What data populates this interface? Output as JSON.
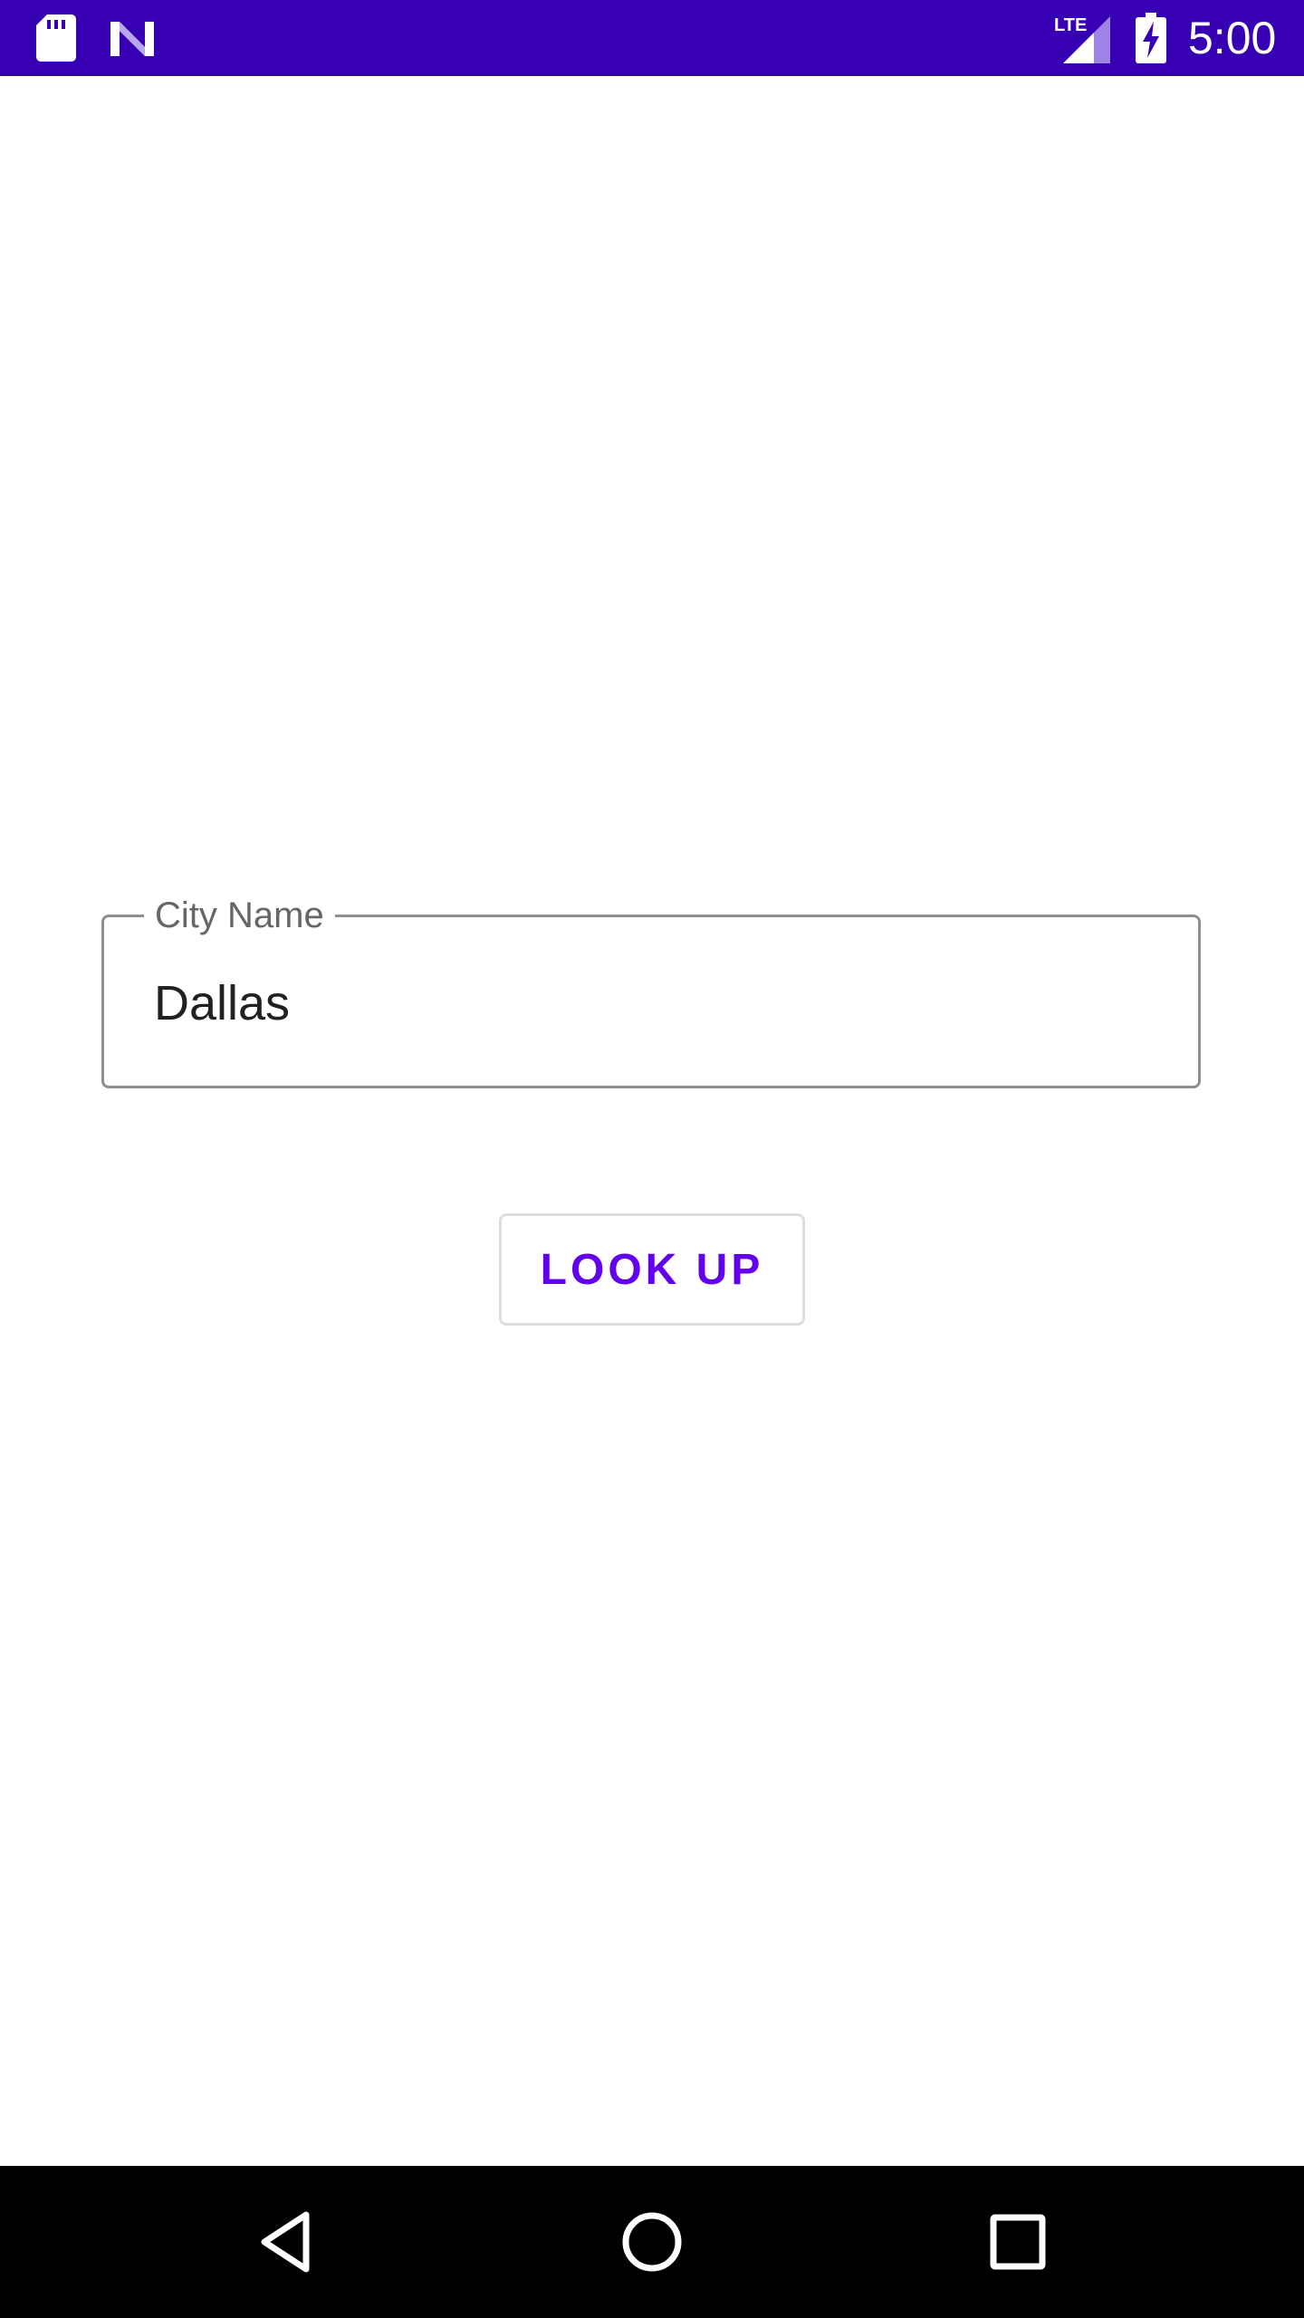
{
  "status_bar": {
    "time": "5:00",
    "network_label": "LTE",
    "background_color": "#3700b3",
    "icons": [
      "sd-card-icon",
      "n-logo-icon",
      "lte-signal-icon",
      "battery-charging-icon"
    ]
  },
  "form": {
    "city_field": {
      "label": "City Name",
      "value": "Dallas"
    },
    "lookup_button": {
      "label": "LOOK UP",
      "color": "#6200ee"
    }
  },
  "nav_bar": {
    "icons": [
      "back-icon",
      "home-icon",
      "recents-icon"
    ]
  }
}
